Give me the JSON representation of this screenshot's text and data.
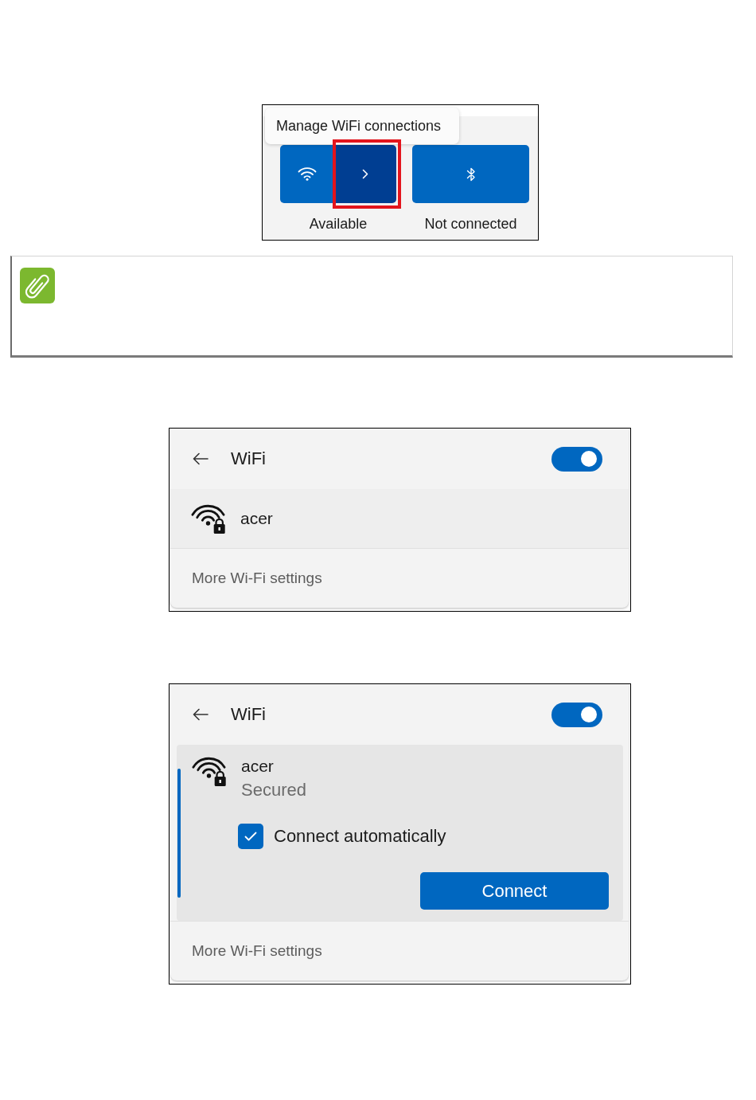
{
  "quick_settings": {
    "tooltip": "Manage WiFi connections",
    "tiles": [
      {
        "kind": "wifi",
        "label": "Available",
        "on": true,
        "arrow_hovered": true,
        "arrow_highlighted": true
      },
      {
        "kind": "bluetooth",
        "label": "Not connected",
        "on": true
      }
    ]
  },
  "note": {
    "kind": "note"
  },
  "wifi_panels": [
    {
      "title": "WiFi",
      "wifi_on": true,
      "networks": [
        {
          "name": "acer",
          "secured": true,
          "selected": false,
          "expanded": false
        }
      ],
      "footer_link": "More Wi-Fi settings"
    },
    {
      "title": "WiFi",
      "wifi_on": true,
      "networks": [
        {
          "name": "acer",
          "secured": true,
          "selected": true,
          "expanded": true,
          "status": "Secured",
          "connect_automatically": {
            "label": "Connect automatically",
            "checked": true
          },
          "button": "Connect"
        }
      ],
      "footer_link": "More Wi-Fi settings"
    }
  ]
}
